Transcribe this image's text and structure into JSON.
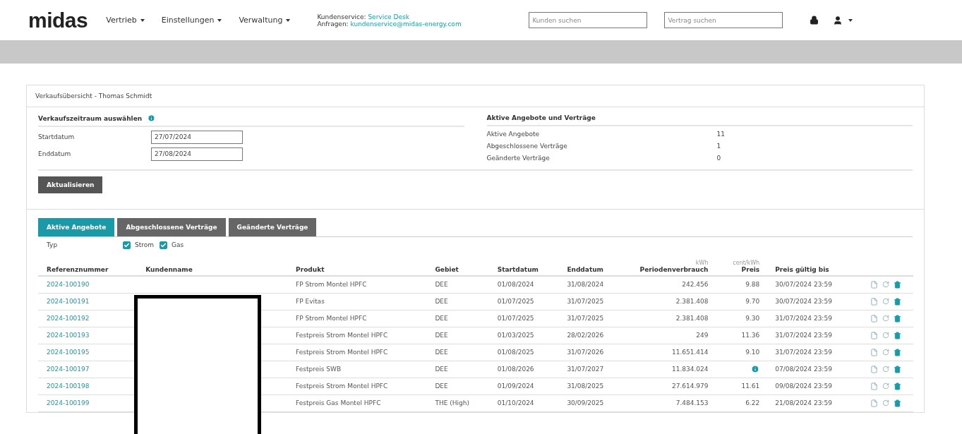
{
  "header": {
    "logo": "midas",
    "menu": [
      {
        "label": "Vertrieb"
      },
      {
        "label": "Einstellungen"
      },
      {
        "label": "Verwaltung"
      }
    ],
    "contact": [
      {
        "label": "Kundenservice:",
        "link": "Service Desk"
      },
      {
        "label": "Anfragen:",
        "link": "kundenservice@midas-energy.com"
      }
    ],
    "search_fields": [
      {
        "placeholder": "Kunden suchen"
      },
      {
        "placeholder": "Vertrag suchen"
      }
    ]
  },
  "panel": {
    "title": "Verkaufsübersicht - Thomas Schmidt",
    "period": {
      "heading": "Verkaufszeitraum auswählen",
      "fields": [
        {
          "label": "Startdatum",
          "value": "27/07/2024"
        },
        {
          "label": "Enddatum",
          "value": "27/08/2024"
        }
      ]
    },
    "summary": {
      "heading": "Aktive Angebote und Verträge",
      "items": [
        {
          "label": "Aktive Angebote",
          "value": "11"
        },
        {
          "label": "Abgeschlossene Verträge",
          "value": "1"
        },
        {
          "label": "Geänderte Verträge",
          "value": "0"
        }
      ]
    },
    "button": "Aktualisieren"
  },
  "tabs": [
    {
      "label": "Aktive Angebote",
      "selected": true
    },
    {
      "label": "Abgeschlossene Verträge",
      "selected": false
    },
    {
      "label": "Geänderte Verträge",
      "selected": false
    }
  ],
  "filter": {
    "label": "Typ",
    "options": [
      {
        "label": "Strom",
        "checked": true
      },
      {
        "label": "Gas",
        "checked": true
      }
    ]
  },
  "table": {
    "columns": [
      {
        "label": "Referenznummer"
      },
      {
        "label": "Kundenname"
      },
      {
        "label": "Produkt"
      },
      {
        "label": "Gebiet"
      },
      {
        "label": "Startdatum"
      },
      {
        "label": "Enddatum"
      },
      {
        "label": "Periodenverbrauch",
        "unit": "kWh"
      },
      {
        "label": "Preis",
        "unit": "cent/kWh"
      },
      {
        "label": "Preis gültig bis"
      }
    ],
    "rows": [
      {
        "ref": "2024-100190",
        "product": "FP Strom Montel HPFC",
        "area": "DEE",
        "start": "01/08/2024",
        "end": "31/08/2024",
        "usage": "242.456",
        "price_info": false,
        "price": "9.88",
        "valid": "30/07/2024 23:59"
      },
      {
        "ref": "2024-100191",
        "product": "FP Evitas",
        "area": "DEE",
        "start": "01/07/2025",
        "end": "31/07/2025",
        "usage": "2.381.408",
        "price_info": false,
        "price": "9.70",
        "valid": "30/07/2024 23:59"
      },
      {
        "ref": "2024-100192",
        "product": "FP Strom Montel HPFC",
        "area": "DEE",
        "start": "01/07/2025",
        "end": "31/07/2025",
        "usage": "2.381.408",
        "price_info": false,
        "price": "9.30",
        "valid": "31/07/2024 23:59"
      },
      {
        "ref": "2024-100193",
        "product": "Festpreis Strom Montel HPFC",
        "area": "DEE",
        "start": "01/03/2025",
        "end": "28/02/2026",
        "usage": "249",
        "price_info": false,
        "price": "11.36",
        "valid": "31/07/2024 23:59"
      },
      {
        "ref": "2024-100195",
        "product": "Festpreis Strom Montel HPFC",
        "area": "DEE",
        "start": "01/08/2025",
        "end": "31/07/2026",
        "usage": "11.651.414",
        "price_info": false,
        "price": "9.10",
        "valid": "31/07/2024 23:59"
      },
      {
        "ref": "2024-100197",
        "product": "Festpreis SWB",
        "area": "DEE",
        "start": "01/08/2026",
        "end": "31/07/2027",
        "usage": "11.834.024",
        "price_info": true,
        "valid": "07/08/2024 23:59"
      },
      {
        "ref": "2024-100198",
        "product": "Festpreis Strom Montel HPFC",
        "area": "DEE",
        "start": "01/09/2024",
        "end": "31/08/2025",
        "usage": "27.614.979",
        "price_info": false,
        "price": "11.61",
        "valid": "09/08/2024 23:59"
      },
      {
        "ref": "2024-100199",
        "product": "Festpreis Gas Montel HPFC",
        "area": "THE (High)",
        "start": "01/10/2024",
        "end": "30/09/2025",
        "usage": "7.484.153",
        "price_info": false,
        "price": "6.22",
        "valid": "21/08/2024 23:59"
      }
    ]
  }
}
